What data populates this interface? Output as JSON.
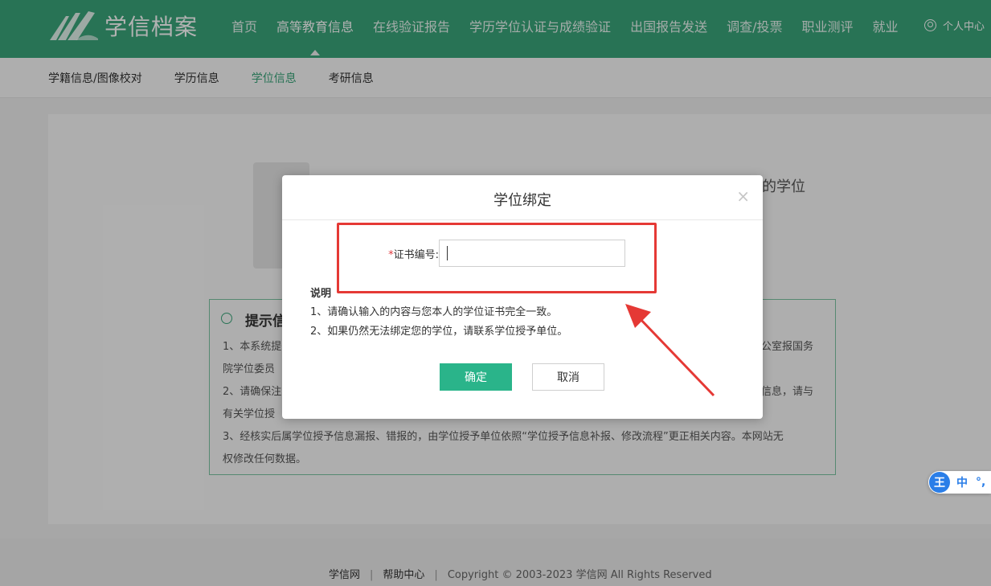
{
  "header": {
    "logo_text": "学信档案",
    "nav": [
      {
        "label": "首页",
        "active": false
      },
      {
        "label": "高等教育信息",
        "active": true
      },
      {
        "label": "在线验证报告",
        "active": false
      },
      {
        "label": "学历学位认证与成绩验证",
        "active": false
      },
      {
        "label": "出国报告发送",
        "active": false
      },
      {
        "label": "调查/投票",
        "active": false
      },
      {
        "label": "职业测评",
        "active": false
      },
      {
        "label": "就业",
        "active": false
      }
    ],
    "user_center": "个人中心"
  },
  "subnav": [
    {
      "label": "学籍信息/图像校对",
      "active": false
    },
    {
      "label": "学历信息",
      "active": false
    },
    {
      "label": "学位信息",
      "active": true
    },
    {
      "label": "考研信息",
      "active": false
    }
  ],
  "background": {
    "partial_heading": "的学位",
    "tip_title": "提示信",
    "tip_lines": [
      "1、本系统提",
      "院学位委员",
      "2、请确保注",
      "有关学位授",
      "3、经核实后属学位授予信息漏报、错报的，由学位授予单位依照“学位授予信息补报、修改流程”更正相关内容。本网站无",
      "权修改任何数据。"
    ],
    "tip_right_fragments": [
      "公室报国务",
      "信息，请与"
    ]
  },
  "modal": {
    "title": "学位绑定",
    "close_symbol": "×",
    "field_label": "证书编号:",
    "required_mark": "*",
    "field_value": "",
    "note_title": "说明",
    "notes": [
      "1、请确认输入的内容与您本人的学位证书完全一致。",
      "2、如果仍然无法绑定您的学位，请联系学位授予单位。"
    ],
    "confirm_label": "确定",
    "cancel_label": "取消"
  },
  "footer": {
    "site_link": "学信网",
    "help_link": "帮助中心",
    "copyright": "Copyright © 2003-2023 学信网 All Rights Reserved"
  },
  "ime": {
    "logo": "王",
    "mode": "中",
    "punct": "°,"
  },
  "colors": {
    "brand": "#3aa57a",
    "primary_button": "#2ab48a",
    "annotation": "#e53935"
  }
}
